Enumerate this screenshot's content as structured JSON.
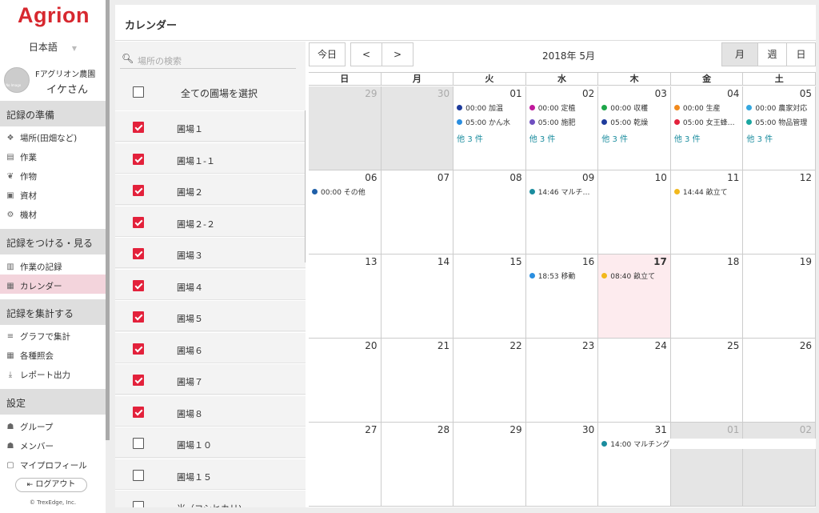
{
  "app": {
    "logo": "Agrion",
    "language": "日本語",
    "avatar_text": "No Image",
    "farm": "Fアグリオン農園",
    "user": "イケさん"
  },
  "nav": {
    "sections": [
      {
        "title": "記録の準備",
        "items": [
          {
            "label": "場所(田畑など)",
            "icon": "field-icon"
          },
          {
            "label": "作業",
            "icon": "work-icon"
          },
          {
            "label": "作物",
            "icon": "crop-icon"
          },
          {
            "label": "資材",
            "icon": "material-icon"
          },
          {
            "label": "機材",
            "icon": "machine-icon"
          }
        ]
      },
      {
        "title": "記録をつける・見る",
        "items": [
          {
            "label": "作業の記録",
            "icon": "record-icon"
          },
          {
            "label": "カレンダー",
            "icon": "calendar-icon"
          }
        ]
      },
      {
        "title": "記録を集計する",
        "items": [
          {
            "label": "グラフで集計",
            "icon": "graph-icon"
          },
          {
            "label": "各種照会",
            "icon": "table-icon"
          },
          {
            "label": "レポート出力",
            "icon": "download-icon"
          }
        ]
      },
      {
        "title": "設定",
        "items": [
          {
            "label": "グループ",
            "icon": "group-icon"
          },
          {
            "label": "メンバー",
            "icon": "members-icon"
          },
          {
            "label": "マイプロフィール",
            "icon": "profile-icon"
          }
        ]
      }
    ],
    "logout": "ログアウト",
    "copyright": "© TrexEdge, Inc."
  },
  "page": {
    "title": "カレンダー"
  },
  "filter": {
    "search_placeholder": "場所の検索",
    "select_all": "全ての圃場を選択",
    "fields": [
      {
        "label": "圃場１",
        "checked": true
      },
      {
        "label": "圃場１-１",
        "checked": true
      },
      {
        "label": "圃場２",
        "checked": true
      },
      {
        "label": "圃場２-２",
        "checked": true
      },
      {
        "label": "圃場３",
        "checked": true
      },
      {
        "label": "圃場４",
        "checked": true
      },
      {
        "label": "圃場５",
        "checked": true
      },
      {
        "label": "圃場６",
        "checked": true
      },
      {
        "label": "圃場７",
        "checked": true
      },
      {
        "label": "圃場８",
        "checked": true
      },
      {
        "label": "圃場１０",
        "checked": false
      },
      {
        "label": "圃場１５",
        "checked": false
      },
      {
        "label": "米（コシヒカリ)",
        "checked": false
      }
    ]
  },
  "calendar": {
    "today_btn": "今日",
    "prev_btn": "<",
    "next_btn": ">",
    "month_label": "2018年 5月",
    "views": [
      "月",
      "週",
      "日"
    ],
    "active_view": "月",
    "weekdays": [
      "日",
      "月",
      "火",
      "水",
      "木",
      "金",
      "土"
    ],
    "weeks": [
      [
        {
          "d": "29",
          "o": true
        },
        {
          "d": "30",
          "o": true
        },
        {
          "d": "01"
        },
        {
          "d": "02"
        },
        {
          "d": "03"
        },
        {
          "d": "04"
        },
        {
          "d": "05"
        }
      ],
      [
        {
          "d": "06"
        },
        {
          "d": "07"
        },
        {
          "d": "08"
        },
        {
          "d": "09"
        },
        {
          "d": "10"
        },
        {
          "d": "11"
        },
        {
          "d": "12"
        }
      ],
      [
        {
          "d": "13"
        },
        {
          "d": "14"
        },
        {
          "d": "15"
        },
        {
          "d": "16"
        },
        {
          "d": "17",
          "today": true
        },
        {
          "d": "18"
        },
        {
          "d": "19"
        }
      ],
      [
        {
          "d": "20"
        },
        {
          "d": "21"
        },
        {
          "d": "22"
        },
        {
          "d": "23"
        },
        {
          "d": "24"
        },
        {
          "d": "25"
        },
        {
          "d": "26"
        }
      ],
      [
        {
          "d": "27"
        },
        {
          "d": "28"
        },
        {
          "d": "29"
        },
        {
          "d": "30"
        },
        {
          "d": "31"
        },
        {
          "d": "01",
          "o": true
        },
        {
          "d": "02",
          "o": true
        }
      ]
    ],
    "events": [
      {
        "w": 0,
        "c": 2,
        "i": 0,
        "text": "00:00 加温",
        "color": "#1f3c9c"
      },
      {
        "w": 0,
        "c": 2,
        "i": 1,
        "text": "05:00 かん水",
        "color": "#2a8ee0"
      },
      {
        "w": 0,
        "c": 3,
        "i": 0,
        "text": "00:00 定植",
        "color": "#c0189c"
      },
      {
        "w": 0,
        "c": 3,
        "i": 1,
        "text": "05:00 施肥",
        "color": "#6f4fc0"
      },
      {
        "w": 0,
        "c": 4,
        "i": 0,
        "text": "00:00 収穫",
        "color": "#1ea64a"
      },
      {
        "w": 0,
        "c": 4,
        "i": 1,
        "text": "05:00 乾燥",
        "color": "#1f3c9c"
      },
      {
        "w": 0,
        "c": 5,
        "i": 0,
        "text": "00:00 生産",
        "color": "#f28a1c"
      },
      {
        "w": 0,
        "c": 5,
        "i": 1,
        "text": "05:00 女王蜂…",
        "color": "#e3213b"
      },
      {
        "w": 0,
        "c": 6,
        "i": 0,
        "text": "00:00 農家対応",
        "color": "#35a8e0"
      },
      {
        "w": 0,
        "c": 6,
        "i": 1,
        "text": "05:00 物品管理",
        "color": "#1aa6a0"
      },
      {
        "w": 1,
        "c": 0,
        "i": 0,
        "text": "00:00 その他",
        "color": "#1f5fa8"
      },
      {
        "w": 1,
        "c": 3,
        "i": 0,
        "text": "14:46 マルチ…",
        "color": "#1a8c9e"
      },
      {
        "w": 1,
        "c": 5,
        "i": 0,
        "text": "14:44 畝立て",
        "color": "#f2b81c"
      },
      {
        "w": 2,
        "c": 3,
        "i": 0,
        "text": "18:53 移動",
        "color": "#2a8ee0"
      },
      {
        "w": 2,
        "c": 4,
        "i": 0,
        "text": "08:40 畝立て",
        "color": "#f2b81c"
      },
      {
        "w": 4,
        "c": 4,
        "i": 0,
        "text": "14:00 マルチング",
        "color": "#1a8c9e",
        "wide": true
      }
    ],
    "more": [
      {
        "w": 0,
        "c": 2,
        "text": "他 3 件"
      },
      {
        "w": 0,
        "c": 3,
        "text": "他 3 件"
      },
      {
        "w": 0,
        "c": 4,
        "text": "他 3 件"
      },
      {
        "w": 0,
        "c": 5,
        "text": "他 3 件"
      },
      {
        "w": 0,
        "c": 6,
        "text": "他 3 件"
      }
    ]
  }
}
